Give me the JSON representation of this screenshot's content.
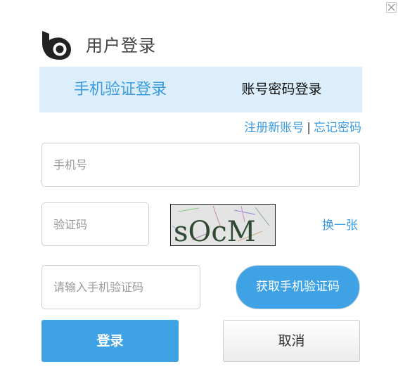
{
  "header": {
    "title": "用户登录",
    "logo_icon": "brand-logo-icon",
    "close_icon": "close-icon"
  },
  "tabs": [
    {
      "label": "手机验证登录",
      "active": true
    },
    {
      "label": "账号密码登录",
      "active": false
    }
  ],
  "links": {
    "register": "注册新账号",
    "separator": "|",
    "forgot_password": "忘记密码"
  },
  "form": {
    "phone_placeholder": "手机号",
    "captcha_placeholder": "验证码",
    "captcha_text": "sOcM",
    "refresh_label": "换一张",
    "sms_code_placeholder": "请输入手机验证码",
    "get_sms_code_label": "获取手机验证码"
  },
  "actions": {
    "login_label": "登录",
    "cancel_label": "取消"
  },
  "colors": {
    "accent": "#3ea2e5",
    "tab_background": "#dceefb",
    "link": "#3a9be0"
  }
}
